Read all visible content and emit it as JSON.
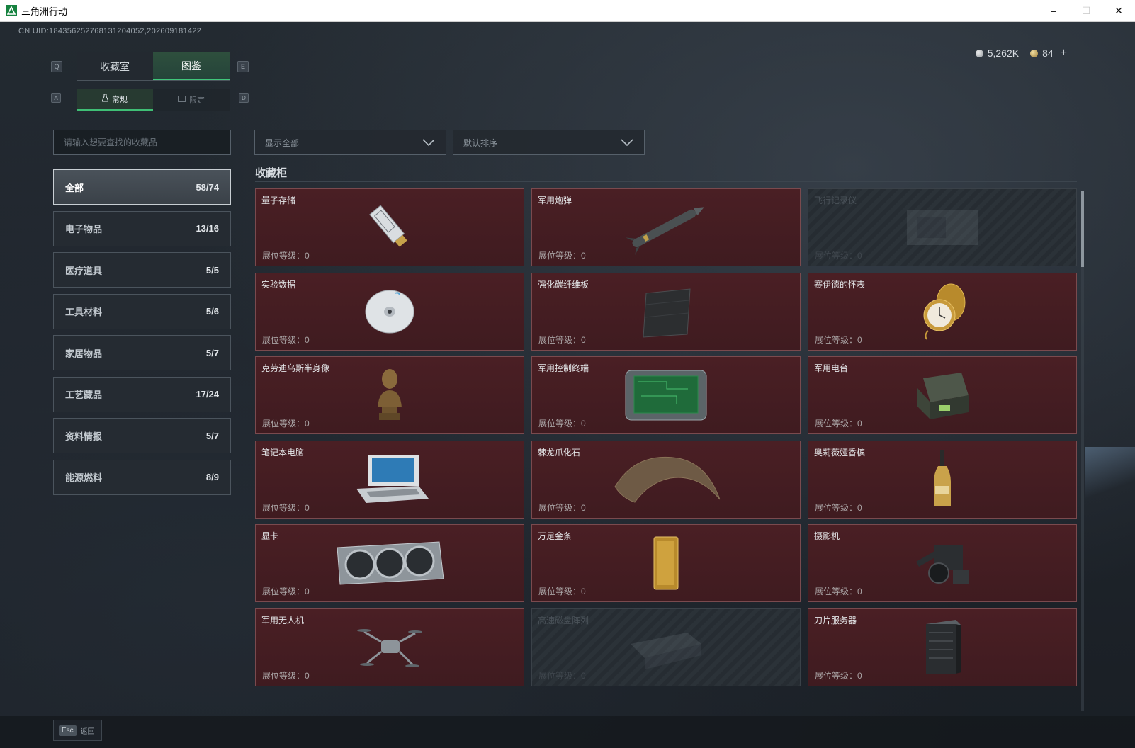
{
  "window": {
    "title": "三角洲行动",
    "minimize": "–",
    "maximize": "☐",
    "close": "✕"
  },
  "uid": "CN UID:184356252768131204052,202609181422",
  "currency": {
    "silver": "5,262K",
    "gold": "84",
    "plus": "+"
  },
  "keys": {
    "q": "Q",
    "e": "E",
    "a": "A",
    "d": "D",
    "esc": "Esc"
  },
  "tabs_main": [
    {
      "label": "收藏室",
      "active": false
    },
    {
      "label": "图鉴",
      "active": true
    }
  ],
  "tabs_sub": [
    {
      "label": "常规",
      "icon": "flask-icon",
      "active": true
    },
    {
      "label": "限定",
      "icon": "frame-icon",
      "active": false
    }
  ],
  "search": {
    "placeholder": "请输入想要查找的收藏品"
  },
  "filters": {
    "show": "显示全部",
    "sort": "默认排序"
  },
  "categories": [
    {
      "label": "全部",
      "count": "58/74",
      "active": true
    },
    {
      "label": "电子物品",
      "count": "13/16"
    },
    {
      "label": "医疗道具",
      "count": "5/5"
    },
    {
      "label": "工具材料",
      "count": "5/6"
    },
    {
      "label": "家居物品",
      "count": "5/7"
    },
    {
      "label": "工艺藏品",
      "count": "17/24"
    },
    {
      "label": "资料情报",
      "count": "5/7"
    },
    {
      "label": "能源燃料",
      "count": "8/9"
    }
  ],
  "section_title": "收藏柜",
  "items": [
    {
      "name": "量子存储",
      "level": "展位等级：0",
      "locked": false,
      "icon": "usb-drive-icon"
    },
    {
      "name": "军用炮弹",
      "level": "展位等级：0",
      "locked": false,
      "icon": "missile-icon"
    },
    {
      "name": "飞行记录仪",
      "level": "展位等级：0",
      "locked": true,
      "icon": "flight-recorder-icon"
    },
    {
      "name": "实验数据",
      "level": "展位等级：0",
      "locked": false,
      "icon": "disc-icon"
    },
    {
      "name": "强化碳纤维板",
      "level": "展位等级：0",
      "locked": false,
      "icon": "carbon-plate-icon"
    },
    {
      "name": "赛伊德的怀表",
      "level": "展位等级：0",
      "locked": false,
      "icon": "pocket-watch-icon"
    },
    {
      "name": "克劳迪乌斯半身像",
      "level": "展位等级：0",
      "locked": false,
      "icon": "bust-icon"
    },
    {
      "name": "军用控制终端",
      "level": "展位等级：0",
      "locked": false,
      "icon": "control-terminal-icon"
    },
    {
      "name": "军用电台",
      "level": "展位等级：0",
      "locked": false,
      "icon": "radio-icon"
    },
    {
      "name": "笔记本电脑",
      "level": "展位等级：0",
      "locked": false,
      "icon": "laptop-icon"
    },
    {
      "name": "棘龙爪化石",
      "level": "展位等级：0",
      "locked": false,
      "icon": "claw-fossil-icon"
    },
    {
      "name": "奥莉薇娅香槟",
      "level": "展位等级：0",
      "locked": false,
      "icon": "champagne-icon"
    },
    {
      "name": "显卡",
      "level": "展位等级：0",
      "locked": false,
      "icon": "gpu-icon"
    },
    {
      "name": "万足金条",
      "level": "展位等级：0",
      "locked": false,
      "icon": "gold-bar-icon"
    },
    {
      "name": "摄影机",
      "level": "展位等级：0",
      "locked": false,
      "icon": "camera-icon"
    },
    {
      "name": "军用无人机",
      "level": "展位等级：0",
      "locked": false,
      "icon": "drone-icon"
    },
    {
      "name": "高速磁盘阵列",
      "level": "展位等级：0",
      "locked": true,
      "icon": "disk-array-icon"
    },
    {
      "name": "刀片服务器",
      "level": "展位等级：0",
      "locked": false,
      "icon": "blade-server-icon"
    }
  ],
  "bottom": {
    "back_label": "返回"
  },
  "colors": {
    "accent_green": "#40c77a",
    "card_red": "#4a1f24",
    "card_border": "#7a4a4e"
  }
}
